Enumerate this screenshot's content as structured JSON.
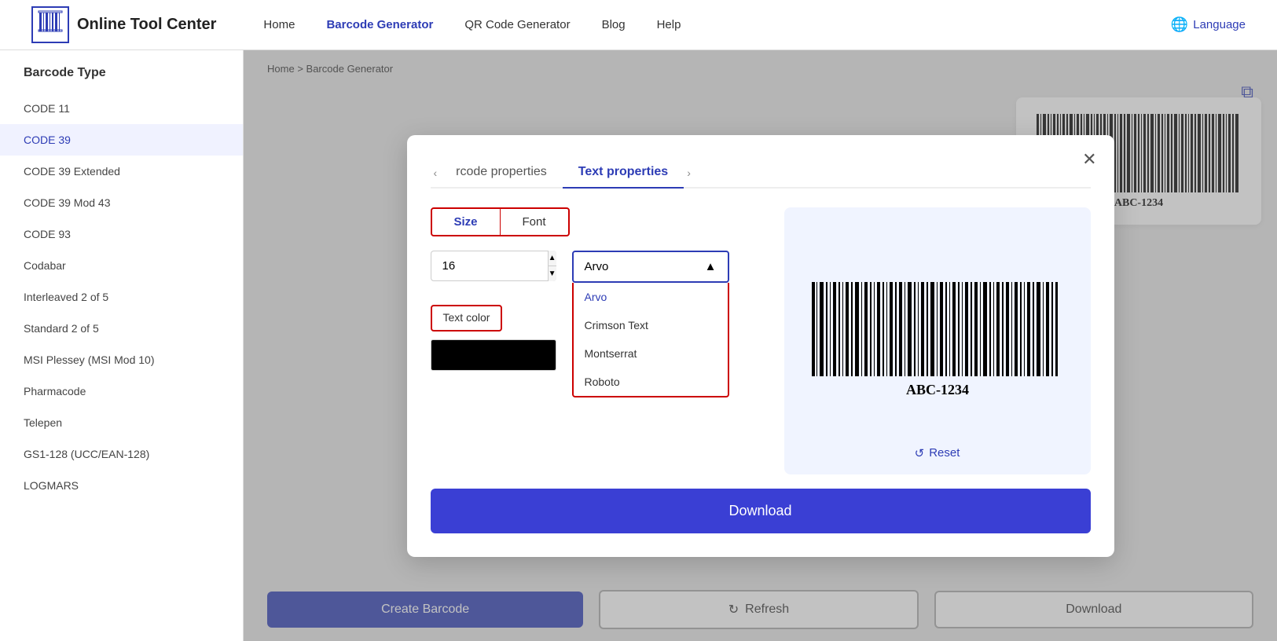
{
  "header": {
    "logo_icon": "|||",
    "logo_text": "Online Tool Center",
    "nav": [
      {
        "label": "Home",
        "active": false
      },
      {
        "label": "Barcode Generator",
        "active": true
      },
      {
        "label": "QR Code Generator",
        "active": false
      },
      {
        "label": "Blog",
        "active": false
      },
      {
        "label": "Help",
        "active": false
      }
    ],
    "language_label": "Language"
  },
  "sidebar": {
    "title": "Barcode Type",
    "items": [
      {
        "label": "CODE 11",
        "active": false
      },
      {
        "label": "CODE 39",
        "active": true
      },
      {
        "label": "CODE 39 Extended",
        "active": false
      },
      {
        "label": "CODE 39 Mod 43",
        "active": false
      },
      {
        "label": "CODE 93",
        "active": false
      },
      {
        "label": "Codabar",
        "active": false
      },
      {
        "label": "Interleaved 2 of 5",
        "active": false
      },
      {
        "label": "Standard 2 of 5",
        "active": false
      },
      {
        "label": "MSI Plessey (MSI Mod 10)",
        "active": false
      },
      {
        "label": "Pharmacode",
        "active": false
      },
      {
        "label": "Telepen",
        "active": false
      },
      {
        "label": "GS1-128 (UCC/EAN-128)",
        "active": false
      },
      {
        "label": "LOGMARS",
        "active": false
      }
    ]
  },
  "breadcrumb": {
    "home": "Home",
    "separator": ">",
    "current": "Barcode Generator"
  },
  "bottom_bar": {
    "create_label": "Create Barcode",
    "refresh_label": "Refresh",
    "download_label": "Download"
  },
  "modal": {
    "tab_prev_label": "‹ rcode properties",
    "tab_active_label": "Text properties",
    "tab_next_arrow": "›",
    "close_label": "✕",
    "prop_tab_size": "Size",
    "prop_tab_font": "Font",
    "size_value": "16",
    "font_selected": "Arvo",
    "font_options": [
      {
        "label": "Arvo",
        "active": true
      },
      {
        "label": "Crimson Text",
        "active": false
      },
      {
        "label": "Montserrat",
        "active": false
      },
      {
        "label": "Roboto",
        "active": false
      }
    ],
    "text_color_label": "Text color",
    "barcode_value": "ABC-1234",
    "reset_label": "Reset",
    "download_label": "Download"
  }
}
